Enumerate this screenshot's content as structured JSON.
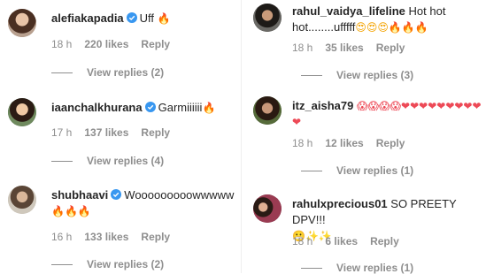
{
  "left_comments": [
    {
      "username": "alefiakapadia",
      "verified": true,
      "text": "Uff",
      "emoji": "🔥",
      "time": "18 h",
      "likes": "220 likes",
      "reply_label": "Reply",
      "view_replies": "View replies (2)"
    },
    {
      "username": "iaanchalkhurana",
      "verified": true,
      "text": "Garmiiiiii",
      "emoji": "🔥",
      "time": "17 h",
      "likes": "137 likes",
      "reply_label": "Reply",
      "view_replies": "View replies (4)"
    },
    {
      "username": "shubhaavi",
      "verified": true,
      "text": "Wooooooooowwwww",
      "emoji": "🔥🔥🔥",
      "time": "16 h",
      "likes": "133 likes",
      "reply_label": "Reply",
      "view_replies": "View replies (2)"
    }
  ],
  "right_comments": [
    {
      "username": "rahul_vaidya_lifeline",
      "verified": false,
      "text": "Hot hot hot........ufffff",
      "emoji": "😍😍😍🔥🔥🔥",
      "time": "18 h",
      "likes": "35 likes",
      "reply_label": "Reply",
      "view_replies": "View replies (3)"
    },
    {
      "username": "itz_aisha79",
      "verified": false,
      "text": "",
      "emoji": "😱😱😱😱❤❤❤❤❤❤❤❤❤❤",
      "time": "18 h",
      "likes": "12 likes",
      "reply_label": "Reply",
      "view_replies": "View replies (1)"
    },
    {
      "username": "rahulxprecious01",
      "verified": false,
      "text": "SO PREETY DPV!!!",
      "emoji": "😬✨✨",
      "time": "18 h",
      "likes": "6 likes",
      "reply_label": "Reply",
      "view_replies": "View replies (1)"
    }
  ],
  "colors": {
    "verified": "#3897f0",
    "meta_text": "#8e8e8e",
    "fire": "#f77f00",
    "heart": "#ed4956"
  }
}
